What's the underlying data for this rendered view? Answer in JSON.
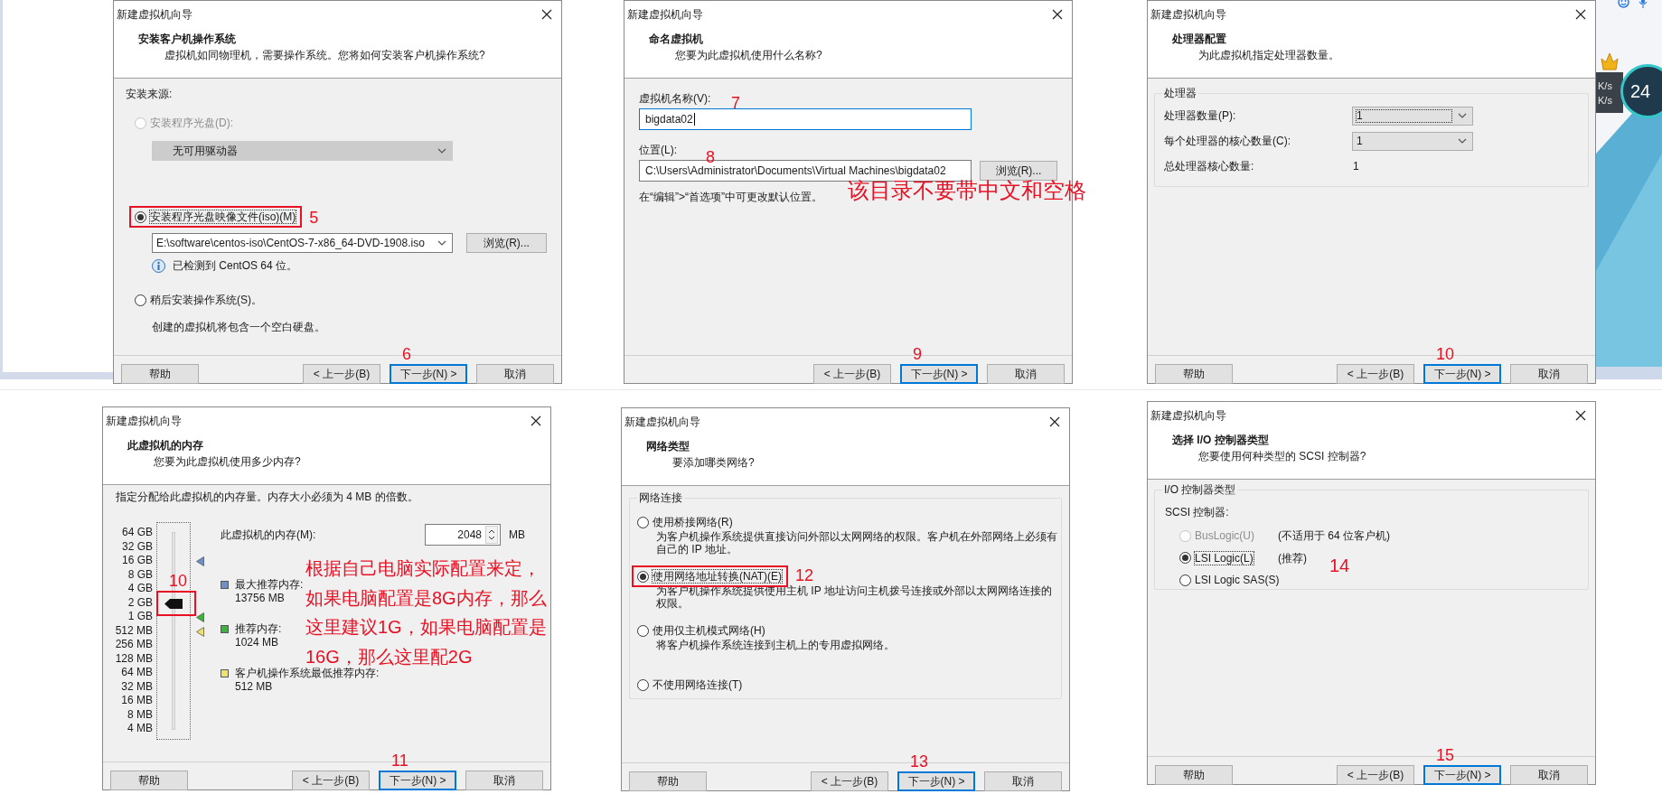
{
  "dialogs": [
    {
      "kind": "install_source",
      "title": "新建虚拟机向导",
      "heading": "安装客户机操作系统",
      "subtitle": "虚拟机如同物理机，需要操作系统。您将如何安装客户机操作系统?",
      "section_label": "安装来源:",
      "options": [
        {
          "label": "安装程序光盘(D):",
          "selected": false,
          "disabled": true,
          "highlighted": false,
          "combo": {
            "value": "无可用驱动器",
            "disabled": true
          }
        },
        {
          "label": "安装程序光盘映像文件(iso)(M)",
          "selected": true,
          "disabled": false,
          "highlighted": true,
          "callout": "5",
          "combo": {
            "value": "E:\\software\\centos-iso\\CentOS-7-x86_64-DVD-1908.iso",
            "disabled": false
          },
          "browse": "浏览(R)...",
          "info": "已检测到 CentOS 64 位。"
        },
        {
          "label": "稍后安装操作系统(S)。",
          "selected": false,
          "disabled": false,
          "highlighted": false,
          "note": "创建的虚拟机将包含一个空白硬盘。"
        }
      ],
      "buttons": [
        {
          "kind": "help",
          "label": "帮助",
          "default": false
        },
        {
          "kind": "back",
          "label": "< 上一步(B)",
          "default": false
        },
        {
          "kind": "next",
          "label": "下一步(N) >",
          "default": true,
          "callout": "6"
        },
        {
          "kind": "cancel",
          "label": "取消",
          "default": false
        }
      ]
    },
    {
      "kind": "name",
      "title": "新建虚拟机向导",
      "heading": "命名虚拟机",
      "subtitle": "您要为此虚拟机使用什么名称?",
      "fields": [
        {
          "label": "虚拟机名称(V):",
          "value": "bigdata02",
          "focused": true,
          "callout": "7"
        },
        {
          "label": "位置(L):",
          "value": "C:\\Users\\Administrator\\Documents\\Virtual Machines\\bigdata02",
          "focused": false,
          "callout": "8",
          "browse": "浏览(R)..."
        }
      ],
      "hint": "在“编辑”>“首选项”中可更改默认位置。",
      "note": "该目录不要带中文和空格",
      "buttons": [
        {
          "kind": "back",
          "label": "< 上一步(B)",
          "default": false
        },
        {
          "kind": "next",
          "label": "下一步(N) >",
          "default": true,
          "callout": "9"
        },
        {
          "kind": "cancel",
          "label": "取消",
          "default": false
        }
      ]
    },
    {
      "kind": "processor",
      "title": "新建虚拟机向导",
      "heading": "处理器配置",
      "subtitle": "为此虚拟机指定处理器数量。",
      "group": "处理器",
      "rows": [
        {
          "kind": "combo",
          "label": "处理器数量(P):",
          "value": "1",
          "focused": true
        },
        {
          "kind": "combo",
          "label": "每个处理器的核心数量(C):",
          "value": "1",
          "focused": false
        },
        {
          "kind": "text",
          "label": "总处理器核心数量:",
          "value": "1"
        }
      ],
      "buttons": [
        {
          "kind": "help",
          "label": "帮助",
          "default": false
        },
        {
          "kind": "back",
          "label": "< 上一步(B)",
          "default": false
        },
        {
          "kind": "next",
          "label": "下一步(N) >",
          "default": true,
          "callout": "10"
        },
        {
          "kind": "cancel",
          "label": "取消",
          "default": false
        }
      ]
    },
    {
      "kind": "memory",
      "title": "新建虚拟机向导",
      "heading": "此虚拟机的内存",
      "subtitle": "您要为此虚拟机使用多少内存?",
      "description": "指定分配给此虚拟机的内存量。内存大小必须为 4 MB 的倍数。",
      "scale": [
        {
          "label": "64 GB"
        },
        {
          "label": "32 GB"
        },
        {
          "label": "16 GB",
          "color": "#6f8fc8"
        },
        {
          "label": "8 GB"
        },
        {
          "label": "4 GB"
        },
        {
          "label": "2 GB"
        },
        {
          "label": "1 GB",
          "color": "#3cb43c"
        },
        {
          "label": "512 MB",
          "color": "#ece46c"
        },
        {
          "label": "256 MB"
        },
        {
          "label": "128 MB"
        },
        {
          "label": "64 MB"
        },
        {
          "label": "32 MB"
        },
        {
          "label": "16 MB"
        },
        {
          "label": "8 MB"
        },
        {
          "label": "4 MB"
        }
      ],
      "slider": {
        "level": 0.643,
        "highlighted": true,
        "callout": "10"
      },
      "memory_field": {
        "label": "此虚拟机的内存(M):",
        "value": "2048",
        "unit": "MB"
      },
      "legend": [
        {
          "color": "#6f8fc8",
          "label": "最大推荐内存:",
          "value": "13756 MB"
        },
        {
          "color": "#3cb43c",
          "label": "推荐内存:",
          "value": "1024 MB"
        },
        {
          "color": "#ece46c",
          "label": "客户机操作系统最低推荐内存:",
          "value": "512 MB"
        }
      ],
      "note": "根据自己电脑实际配置来定，如果电脑配置是8G内存，那么这里建议1G，如果电脑配置是16G，那么这里配2G",
      "buttons": [
        {
          "kind": "help",
          "label": "帮助",
          "default": false
        },
        {
          "kind": "back",
          "label": "< 上一步(B)",
          "default": false
        },
        {
          "kind": "next",
          "label": "下一步(N) >",
          "default": true,
          "callout": "11"
        },
        {
          "kind": "cancel",
          "label": "取消",
          "default": false
        }
      ]
    },
    {
      "kind": "network",
      "title": "新建虚拟机向导",
      "heading": "网络类型",
      "subtitle": "要添加哪类网络?",
      "group": "网络连接",
      "options": [
        {
          "label": "使用桥接网络(R)",
          "description": "为客户机操作系统提供直接访问外部以太网网络的权限。客户机在外部网络上必须有自己的 IP 地址。",
          "selected": false,
          "disabled": false,
          "highlighted": false
        },
        {
          "label": "使用网络地址转换(NAT)(E)",
          "description": "为客户机操作系统提供使用主机 IP 地址访问主机拨号连接或外部以太网网络连接的权限。",
          "selected": true,
          "disabled": false,
          "highlighted": true,
          "callout": "12"
        },
        {
          "label": "使用仅主机模式网络(H)",
          "description": "将客户机操作系统连接到主机上的专用虚拟网络。",
          "selected": false,
          "disabled": false,
          "highlighted": false
        },
        {
          "label": "不使用网络连接(T)",
          "selected": false,
          "disabled": false,
          "highlighted": false
        }
      ],
      "buttons": [
        {
          "kind": "help",
          "label": "帮助",
          "default": false
        },
        {
          "kind": "back",
          "label": "< 上一步(B)",
          "default": false
        },
        {
          "kind": "next",
          "label": "下一步(N) >",
          "default": true,
          "callout": "13"
        },
        {
          "kind": "cancel",
          "label": "取消",
          "default": false
        }
      ]
    },
    {
      "kind": "io_controller",
      "title": "新建虚拟机向导",
      "heading": "选择 I/O 控制器类型",
      "subtitle": "您要使用何种类型的 SCSI 控制器?",
      "group": "I/O 控制器类型",
      "section_label": "SCSI 控制器:",
      "options": [
        {
          "label": "BusLogic(U)",
          "note": "(不适用于 64 位客户机)",
          "selected": false,
          "disabled": true,
          "highlighted": false
        },
        {
          "label": "LSI Logic(L)",
          "note": "(推荐)",
          "selected": true,
          "disabled": false,
          "highlighted": false,
          "callout": "14"
        },
        {
          "label": "LSI Logic SAS(S)",
          "selected": false,
          "disabled": false,
          "highlighted": false
        }
      ],
      "buttons": [
        {
          "kind": "help",
          "label": "帮助",
          "default": false
        },
        {
          "kind": "back",
          "label": "< 上一步(B)",
          "default": false
        },
        {
          "kind": "next",
          "label": "下一步(N) >",
          "default": true,
          "callout": "15"
        },
        {
          "kind": "cancel",
          "label": "取消",
          "default": false
        }
      ]
    }
  ],
  "desktop_widget": {
    "speeds": [
      "K/s",
      "K/s"
    ],
    "gauge": "24"
  }
}
